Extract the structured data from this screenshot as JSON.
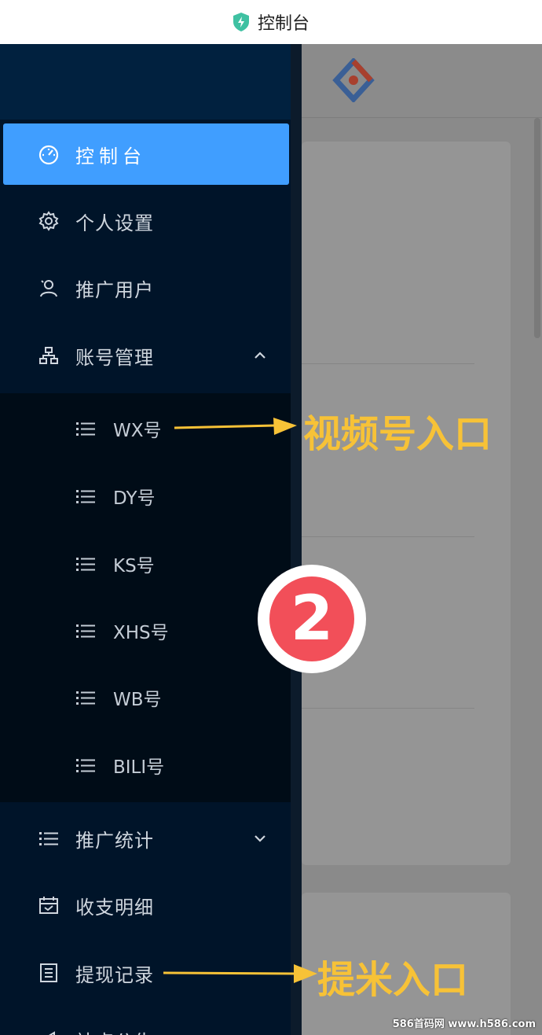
{
  "topbar": {
    "title": "控制台",
    "icon": "shield-bolt-icon",
    "icon_color": "#3fc1a2"
  },
  "sidebar": {
    "items": [
      {
        "label": "控制台",
        "icon": "dashboard-gauge-icon",
        "active": true
      },
      {
        "label": "个人设置",
        "icon": "gear-icon"
      },
      {
        "label": "推广用户",
        "icon": "user-icon"
      },
      {
        "label": "账号管理",
        "icon": "org-tree-icon",
        "expanded": true
      },
      {
        "label": "推广统计",
        "icon": "list-icon",
        "expanded": false
      },
      {
        "label": "收支明细",
        "icon": "calendar-check-icon"
      },
      {
        "label": "提现记录",
        "icon": "document-list-icon"
      },
      {
        "label": "站点公告",
        "icon": "megaphone-icon"
      }
    ],
    "account_subitems": [
      {
        "label": "WX号",
        "icon": "list-icon"
      },
      {
        "label": "DY号",
        "icon": "list-icon"
      },
      {
        "label": "KS号",
        "icon": "list-icon"
      },
      {
        "label": "XHS号",
        "icon": "list-icon"
      },
      {
        "label": "WB号",
        "icon": "list-icon"
      },
      {
        "label": "BILI号",
        "icon": "list-icon"
      }
    ]
  },
  "annotations": {
    "video_entry": "视频号入口",
    "withdraw_entry": "提米入口",
    "step_badge": "2"
  },
  "watermark": "586首码网 www.h586.com",
  "colors": {
    "accent": "#409eff",
    "sidebar_bg": "#001429",
    "annotation": "#f7c237",
    "badge": "#f24f59"
  }
}
